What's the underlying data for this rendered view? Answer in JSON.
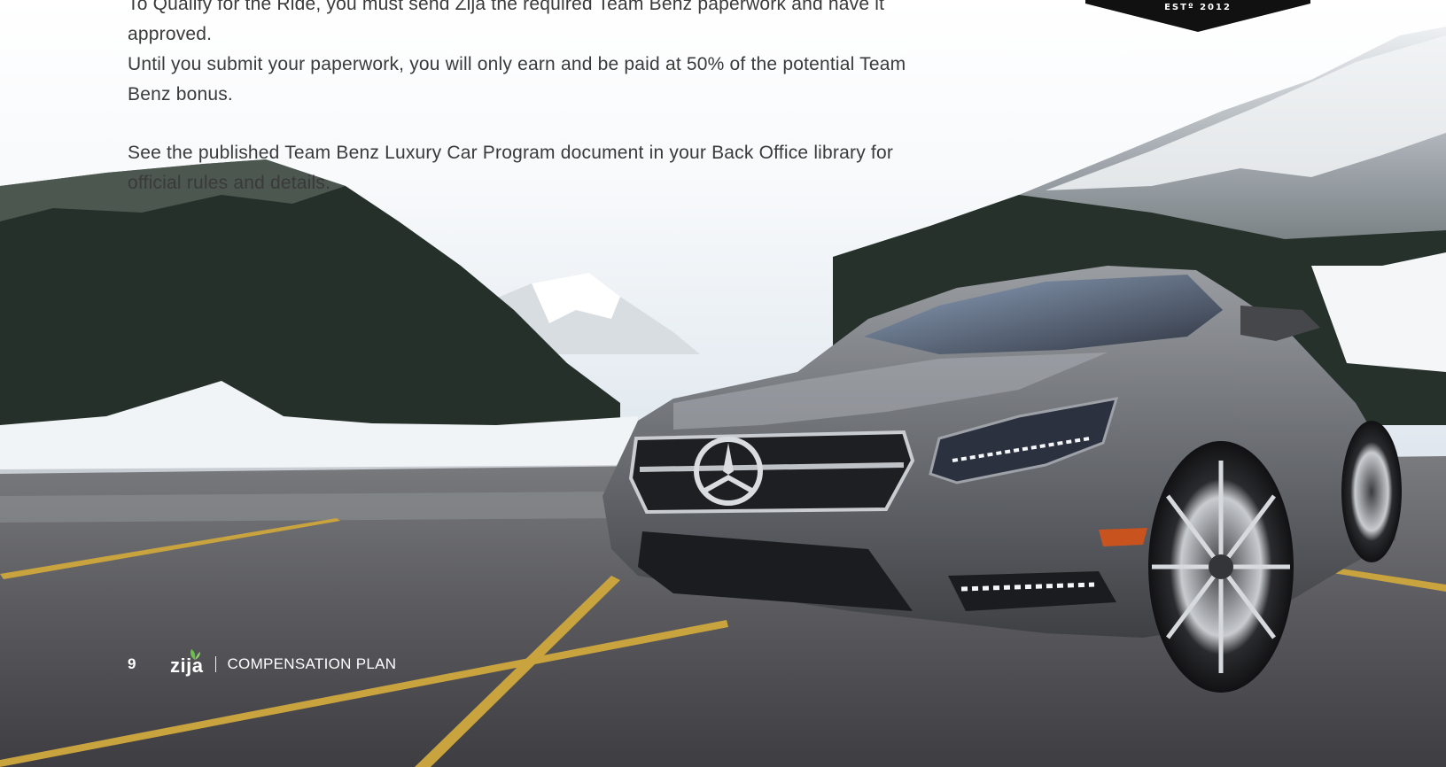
{
  "body_text": {
    "paragraph_1_line_1": "To Qualify for the Ride, you must send Zija the required Team Benz paperwork and have it approved.",
    "paragraph_1_line_2": "Until you submit your paperwork, you will only earn and be paid at 50% of the potential Team",
    "paragraph_1_line_3": "Benz bonus.",
    "paragraph_2_line_1": "See the published Team Benz Luxury Car Program document in your Back Office library for",
    "paragraph_2_line_2": "official rules and details."
  },
  "badge": {
    "text": "ESTº 2012",
    "color": "#111111"
  },
  "footer": {
    "page_number": "9",
    "logo_text": "zija",
    "section_label": "COMPENSATION PLAN"
  },
  "colors": {
    "text": "#3a3a3a",
    "footer_text": "#ffffff",
    "car_paint": "#6e7176",
    "parking_line": "#c9a33e",
    "asphalt": "#55555a",
    "logo_leaf": "#6cc04a"
  }
}
